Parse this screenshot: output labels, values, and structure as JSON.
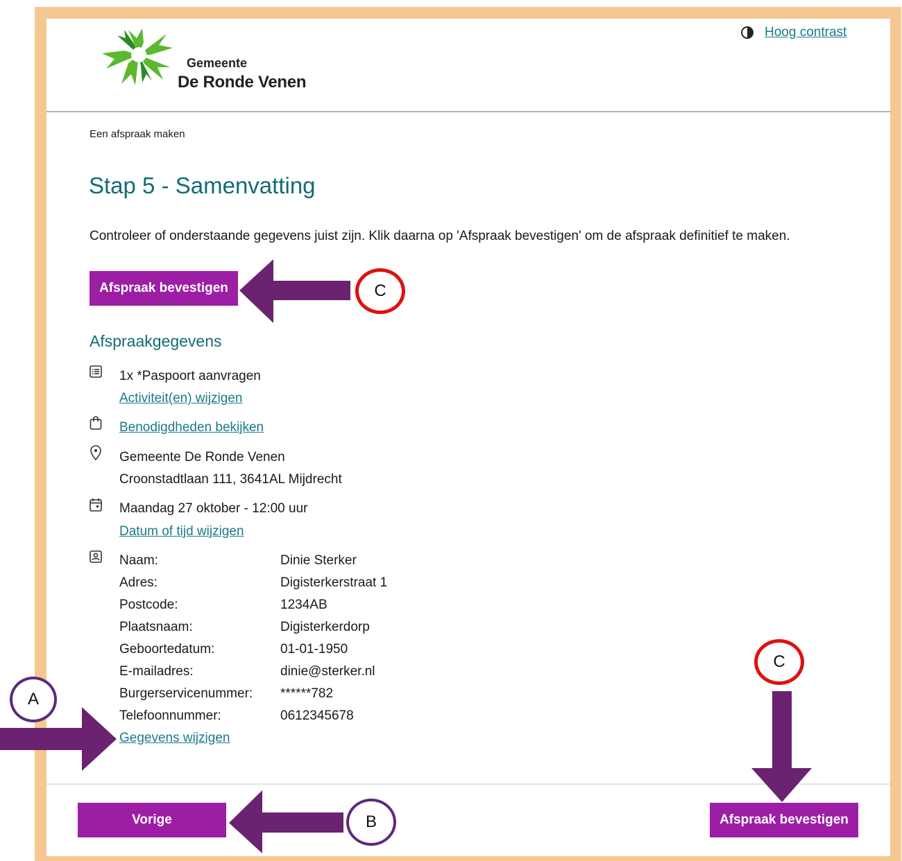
{
  "header": {
    "logo_line1": "Gemeente",
    "logo_line2": "De Ronde Venen",
    "contrast_label": "Hoog contrast"
  },
  "breadcrumb": "Een afspraak maken",
  "title": "Stap 5 - Samenvatting",
  "intro": "Controleer of onderstaande gegevens juist zijn. Klik daarna op 'Afspraak bevestigen' om de afspraak definitief te maken.",
  "confirm_label": "Afspraak bevestigen",
  "section_title": "Afspraakgegevens",
  "activity": {
    "text": "1x  *Paspoort aanvragen",
    "change_link": "Activiteit(en) wijzigen"
  },
  "requirements_link": "Benodigdheden bekijken",
  "location": {
    "name": "Gemeente De Ronde Venen",
    "address": "Croonstadtlaan 111, 3641AL Mijdrecht"
  },
  "datetime": {
    "text": "Maandag 27 oktober - 12:00 uur",
    "change_link": "Datum of tijd wijzigen"
  },
  "personal": [
    {
      "label": "Naam:",
      "value": "Dinie Sterker"
    },
    {
      "label": "Adres:",
      "value": "Digisterkerstraat 1"
    },
    {
      "label": "Postcode:",
      "value": "1234AB"
    },
    {
      "label": "Plaatsnaam:",
      "value": "Digisterkerdorp"
    },
    {
      "label": "Geboortedatum:",
      "value": "01-01-1950"
    },
    {
      "label": "E-mailadres:",
      "value": "dinie@sterker.nl"
    },
    {
      "label": "Burgerservicenummer:",
      "value": "******782"
    },
    {
      "label": "Telefoonnummer:",
      "value": "0612345678"
    }
  ],
  "personal_change_link": "Gegevens wijzigen",
  "footer": {
    "prev_label": "Vorige",
    "confirm_label": "Afspraak bevestigen"
  },
  "annotations": {
    "a": "A",
    "b": "B",
    "c": "C",
    "arrow_color": "#6b2270",
    "circle_red": "#e01010",
    "circle_purple": "#5e2a7c"
  }
}
